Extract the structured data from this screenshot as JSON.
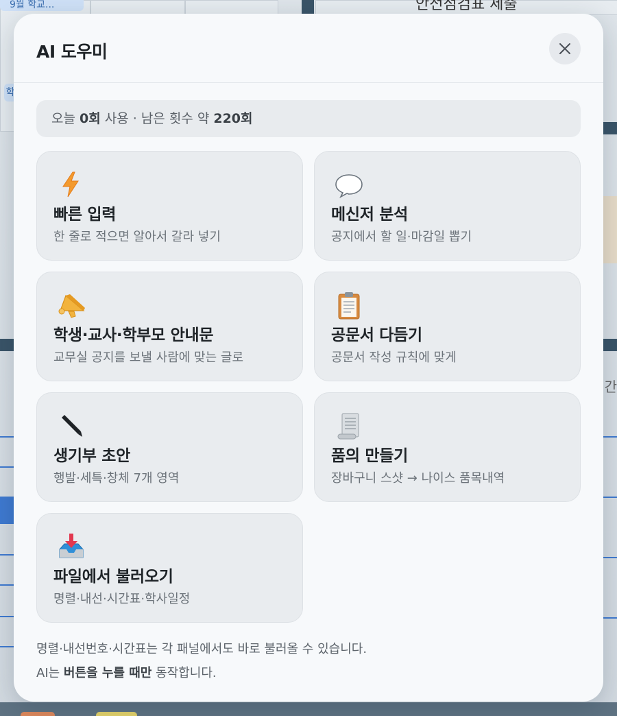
{
  "background": {
    "chip_label": "9월 학교...",
    "chip2_label": "학",
    "title_partial": "안전점검표 제출",
    "side_text": "간"
  },
  "modal": {
    "title": "AI 도우미",
    "close_icon": "close-icon",
    "usage": {
      "prefix": "오늘 ",
      "count": "0회",
      "middle": " 사용 · 남은 횟수 약 ",
      "remaining": "220회"
    },
    "cards": [
      {
        "icon": "lightning-icon",
        "title": "빠른 입력",
        "desc": "한 줄로 적으면 알아서 갈라 넣기"
      },
      {
        "icon": "speech-bubble-icon",
        "title": "메신저 분석",
        "desc": "공지에서 할 일·마감일 뽑기"
      },
      {
        "icon": "megaphone-icon",
        "title": "학생·교사·학부모 안내문",
        "desc": "교무실 공지를 보낼 사람에 맞는 글로"
      },
      {
        "icon": "clipboard-icon",
        "title": "공문서 다듬기",
        "desc": "공문서 작성 규칙에 맞게"
      },
      {
        "icon": "pencil-icon",
        "title": "생기부 초안",
        "desc": "행발·세특·창체 7개 영역"
      },
      {
        "icon": "scroll-icon",
        "title": "품의 만들기",
        "desc": "장바구니 스샷 → 나이스 품목내역"
      },
      {
        "icon": "inbox-tray-icon",
        "title": "파일에서 불러오기",
        "desc": "명렬·내선·시간표·학사일정"
      }
    ],
    "footnote": {
      "line1": "명렬·내선번호·시간표는 각 패널에서도 바로 불러올 수 있습니다.",
      "line2_prefix": "AI는 ",
      "line2_bold": "버튼을 누를 때만",
      "line2_suffix": " 동작합니다."
    }
  }
}
